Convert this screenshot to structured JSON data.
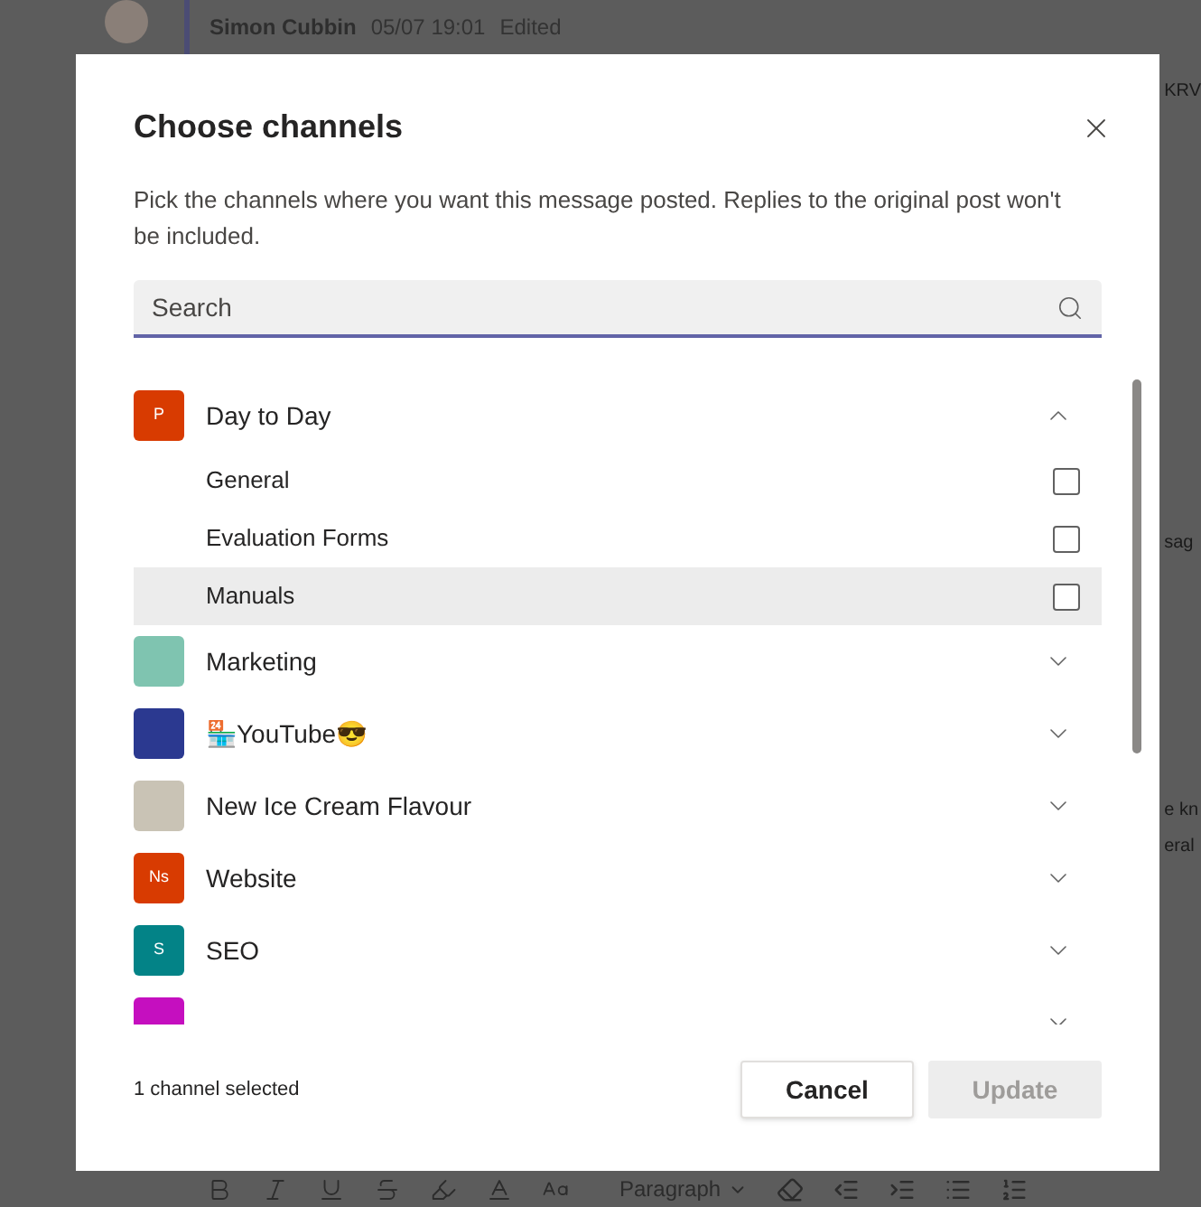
{
  "background": {
    "author": "Simon Cubbin",
    "time": "05/07 19:01",
    "status": "Edited",
    "fragments": [
      "KRV",
      "sag",
      "e kn",
      "eral"
    ],
    "format_menu": "Paragraph"
  },
  "dialog": {
    "title": "Choose channels",
    "description": "Pick the channels where you want this message posted. Replies to the original post won't be included.",
    "search": {
      "placeholder": "Search"
    },
    "teams": [
      {
        "name": "Day to Day",
        "avatar": {
          "kind": "letters",
          "text": "P",
          "color": "#d83b01"
        },
        "expanded": true,
        "channels": [
          {
            "name": "General",
            "checked": false,
            "hovered": false
          },
          {
            "name": "Evaluation Forms",
            "checked": false,
            "hovered": false
          },
          {
            "name": "Manuals",
            "checked": false,
            "hovered": true
          }
        ]
      },
      {
        "name": "Marketing",
        "avatar": {
          "kind": "picture",
          "color": "#7fc4b0"
        },
        "expanded": false
      },
      {
        "name": "🏪YouTube😎",
        "avatar": {
          "kind": "picture",
          "color": "#2b3990"
        },
        "expanded": false
      },
      {
        "name": "New Ice Cream Flavour",
        "avatar": {
          "kind": "picture",
          "color": "#c9c3b5"
        },
        "expanded": false
      },
      {
        "name": "Website",
        "avatar": {
          "kind": "letters",
          "text": "Ns",
          "color": "#d83b01"
        },
        "expanded": false
      },
      {
        "name": "SEO",
        "avatar": {
          "kind": "letters",
          "text": "S",
          "color": "#038387"
        },
        "expanded": false
      },
      {
        "avatar": {
          "kind": "letters",
          "color": "#c50fbf"
        },
        "expanded": false
      }
    ],
    "footer": {
      "selection": "1 channel selected",
      "buttons": [
        {
          "label": "Cancel",
          "kind": "secondary",
          "disabled": false
        },
        {
          "label": "Update",
          "kind": "primary",
          "disabled": true
        }
      ]
    }
  }
}
